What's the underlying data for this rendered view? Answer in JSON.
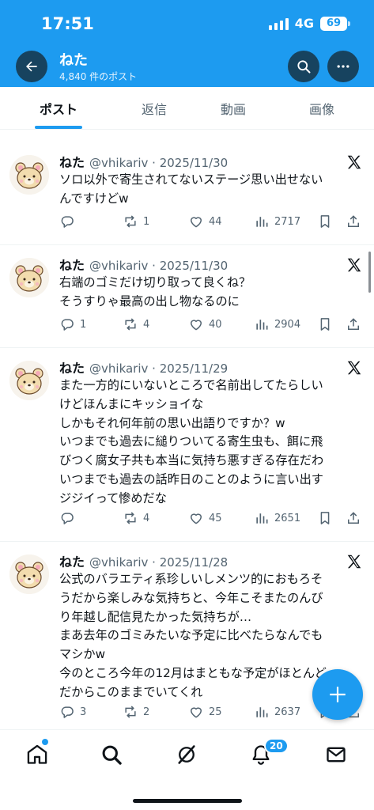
{
  "status_bar": {
    "time": "17:51",
    "network": "4G",
    "battery": "69"
  },
  "profile": {
    "name": "ねた",
    "post_count": "4,840 件のポスト"
  },
  "tabs": [
    {
      "label": "ポスト"
    },
    {
      "label": "返信"
    },
    {
      "label": "動画"
    },
    {
      "label": "画像"
    }
  ],
  "posts": [
    {
      "name": "ねた",
      "meta": "@vhikariv · 2025/11/30",
      "lines": [
        "ソロ以外で寄生されてないステージ思い出せない",
        "んですけどw"
      ],
      "replies": "",
      "reposts": "1",
      "likes": "44",
      "views": "2717"
    },
    {
      "name": "ねた",
      "meta": "@vhikariv · 2025/11/30",
      "lines": [
        "右端のゴミだけ切り取って良くね？",
        "そうすりゃ最高の出し物なるのに"
      ],
      "replies": "1",
      "reposts": "4",
      "likes": "40",
      "views": "2904"
    },
    {
      "name": "ねた",
      "meta": "@vhikariv · 2025/11/29",
      "lines": [
        "また一方的にいないところで名前出してたらしい",
        "けどほんまにキッショイな",
        "しかもそれ何年前の思い出語りですか？w",
        "いつまでも過去に縋りついてる寄生虫も、餌に飛",
        "びつく腐女子共も本当に気持ち悪すぎる存在だわ",
        "いつまでも過去の話昨日のことのように言い出す",
        "ジジイって惨めだな"
      ],
      "replies": "",
      "reposts": "4",
      "likes": "45",
      "views": "2651"
    },
    {
      "name": "ねた",
      "meta": "@vhikariv · 2025/11/28",
      "lines": [
        "公式のバラエティ系珍しいしメンツ的におもろそ",
        "うだから楽しみな気持ちと、今年こそまたのんび",
        "り年越し配信見たかった気持ちが…",
        "まあ去年のゴミみたいな予定に比べたらなんでも",
        "マシかw",
        "今のところ今年の12月はまともな予定がほとんど",
        "だからこのままでいてくれ"
      ],
      "replies": "3",
      "reposts": "2",
      "likes": "25",
      "views": "2637"
    }
  ],
  "bottom_nav": {
    "notifications_badge": "20"
  },
  "icons": {
    "back": "arrow-left-icon",
    "search": "search-icon",
    "more": "more-horizontal-icon",
    "x_logo": "x-logo-icon",
    "reply": "reply-icon",
    "repost": "repost-icon",
    "like": "heart-icon",
    "views": "views-icon",
    "bookmark": "bookmark-icon",
    "share": "share-icon",
    "compose": "plus-icon",
    "home": "home-icon",
    "explore": "search-icon",
    "grok": "grok-icon",
    "notifications": "bell-icon",
    "messages": "envelope-icon"
  },
  "colors": {
    "brand": "#1d9bf0",
    "text": "#0f1419",
    "muted": "#536471"
  }
}
